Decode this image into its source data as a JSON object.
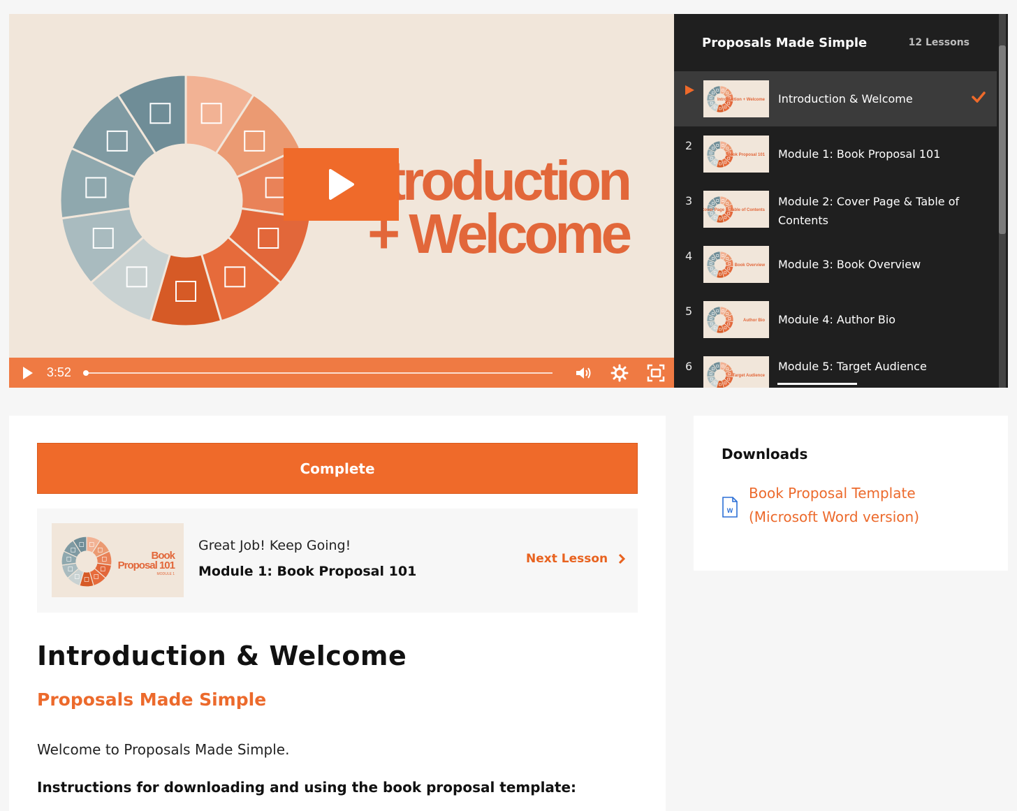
{
  "player": {
    "slide_title_line1": "Introduction",
    "slide_title_line2": "+ Welcome",
    "current_time": "3:52",
    "progress": 0.0
  },
  "playlist": {
    "title": "Proposals Made Simple",
    "count_label": "12 Lessons",
    "items": [
      {
        "number": "",
        "label": "Introduction & Welcome",
        "thumb_text": "Introduction + Welcome",
        "active": true,
        "completed": true
      },
      {
        "number": "2",
        "label": "Module 1: Book Proposal 101",
        "thumb_text": "Book Proposal 101"
      },
      {
        "number": "3",
        "label": "Module 2: Cover Page & Table of Contents",
        "thumb_text": "Cover Page & Table of Contents"
      },
      {
        "number": "4",
        "label": "Module 3: Book Overview",
        "thumb_text": "Book Overview"
      },
      {
        "number": "5",
        "label": "Module 4: Author Bio",
        "thumb_text": "Author Bio"
      },
      {
        "number": "6",
        "label": "Module 5: Target Audience",
        "thumb_text": "Target Audience"
      }
    ]
  },
  "main": {
    "complete_label": "Complete",
    "next": {
      "kicker": "Great Job! Keep Going!",
      "title": "Module 1: Book Proposal 101",
      "link_label": "Next Lesson",
      "thumb_line1": "Book",
      "thumb_line2": "Proposal 101",
      "thumb_line3": "MODULE 1"
    },
    "lesson_title": "Introduction & Welcome",
    "course_name": "Proposals Made Simple",
    "welcome_text": "Welcome to  Proposals Made Simple.",
    "instructions": "Instructions for downloading and using the book proposal template:"
  },
  "downloads": {
    "title": "Downloads",
    "file_link": "Book Proposal Template (Microsoft Word version)",
    "file_icon": "word-document-icon"
  },
  "colors": {
    "accent": "#ef6a2a",
    "slide_bg": "#f1e6da",
    "playlist_bg": "#1f1f1f",
    "wheel_blue": "#6f8d97",
    "wheel_orange": "#e2673a"
  }
}
